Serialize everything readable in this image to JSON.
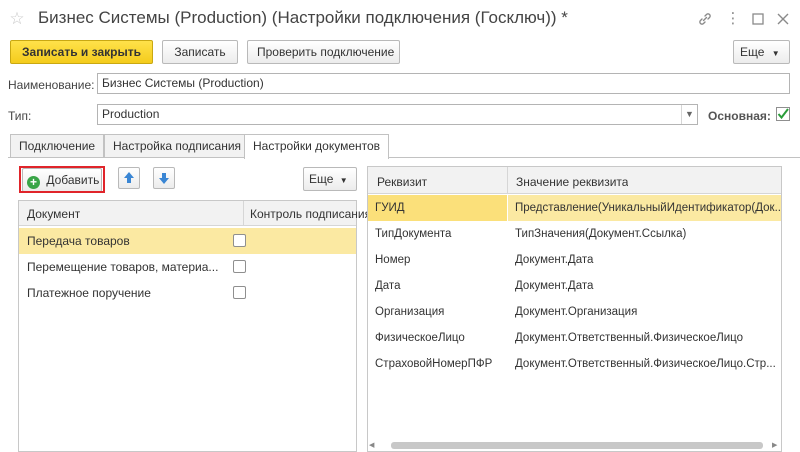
{
  "window": {
    "title": "Бизнес Системы (Production) (Настройки подключения (Госключ)) *"
  },
  "toolbar": {
    "save_close_label": "Записать и закрыть",
    "save_label": "Записать",
    "check_connection_label": "Проверить подключение",
    "more_label": "Еще"
  },
  "form": {
    "name_label": "Наименование:",
    "name_value": "Бизнес Системы (Production)",
    "type_label": "Тип:",
    "type_value": "Production",
    "main_label": "Основная:",
    "main_checked": true
  },
  "tabs": [
    {
      "label": "Подключение"
    },
    {
      "label": "Настройка подписания"
    },
    {
      "label": "Настройки документов"
    }
  ],
  "documents_panel": {
    "add_label": "Добавить",
    "more_label": "Еще",
    "columns": [
      "Документ",
      "Контроль подписания"
    ],
    "rows": [
      {
        "document": "Передача товаров",
        "control": false
      },
      {
        "document": "Перемещение товаров, материа...",
        "control": false
      },
      {
        "document": "Платежное поручение",
        "control": false
      }
    ]
  },
  "attributes_panel": {
    "columns": [
      "Реквизит",
      "Значение реквизита"
    ],
    "rows": [
      {
        "attr": "ГУИД",
        "value": "Представление(УникальныйИдентификатор(Док..."
      },
      {
        "attr": "ТипДокумента",
        "value": "ТипЗначения(Документ.Ссылка)"
      },
      {
        "attr": "Номер",
        "value": "Документ.Дата"
      },
      {
        "attr": "Дата",
        "value": "Документ.Дата"
      },
      {
        "attr": "Организация",
        "value": "Документ.Организация"
      },
      {
        "attr": "ФизическоеЛицо",
        "value": "Документ.Ответственный.ФизическоеЛицо"
      },
      {
        "attr": "СтраховойНомерПФР",
        "value": "Документ.Ответственный.ФизическоеЛицо.Стр..."
      }
    ]
  },
  "colors": {
    "primary_button": "#f4cc1c",
    "selection": "#fbe9a2",
    "highlight_border": "#e0242a",
    "check_green": "#2a9d3a",
    "arrow_blue": "#3a86d4"
  }
}
